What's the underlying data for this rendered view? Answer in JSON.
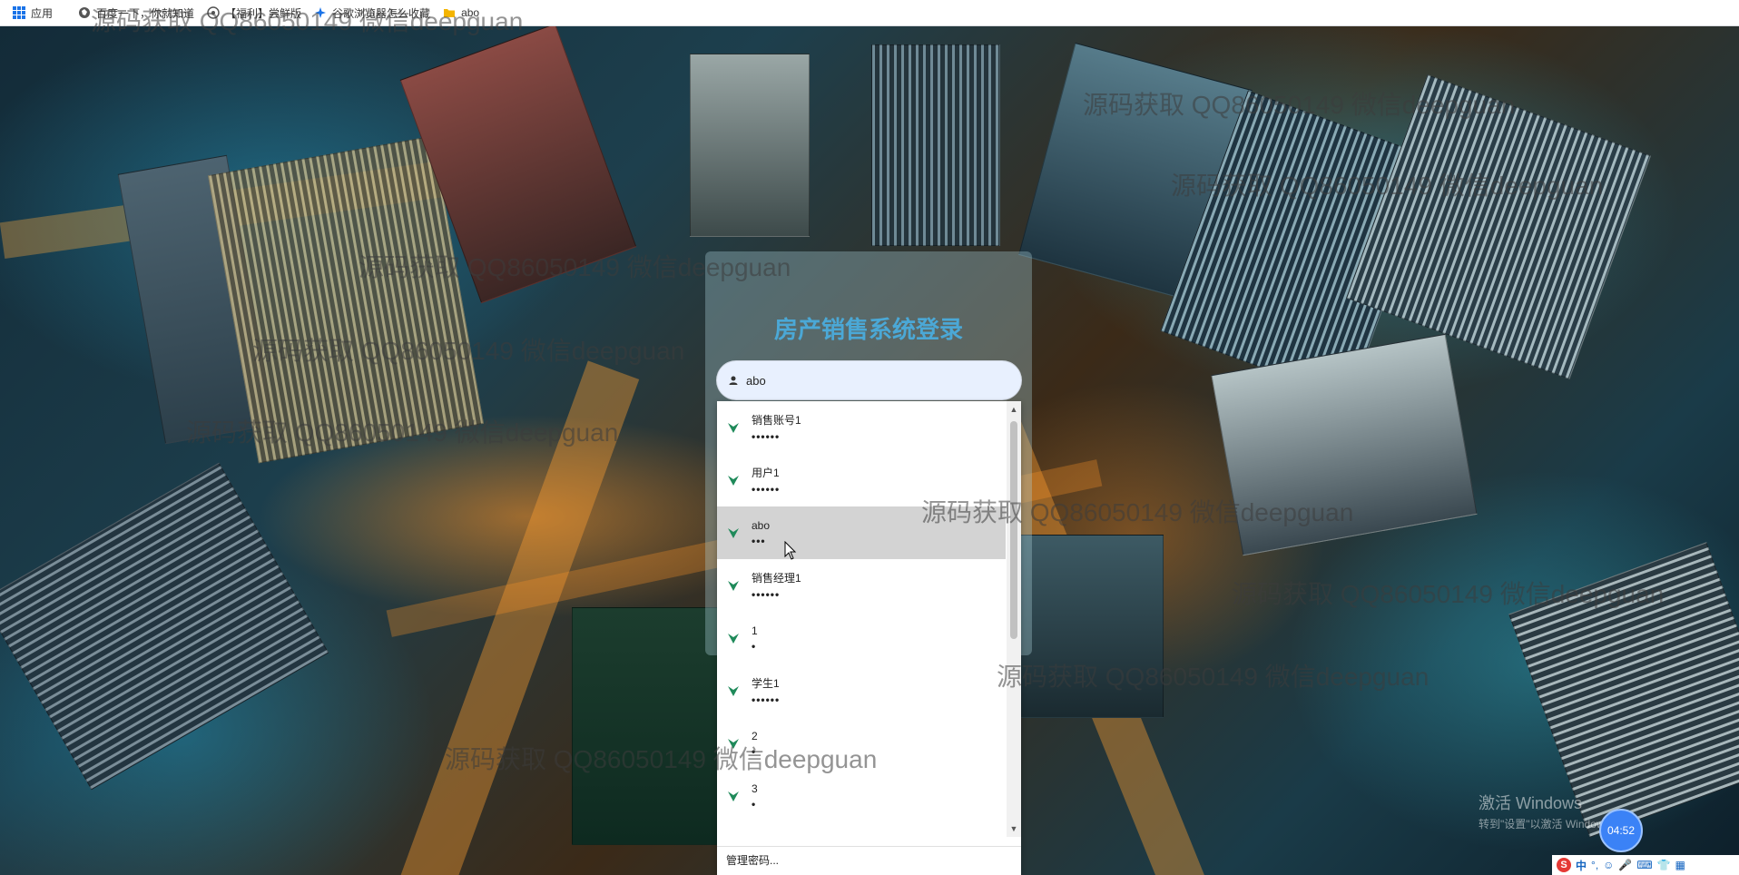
{
  "bookmarks": [
    {
      "icon": "apps-grid-icon",
      "label": "应用"
    },
    {
      "icon": "globe-icon",
      "label": "百度一下，你就知道"
    },
    {
      "icon": "globe-icon",
      "label": "【福利】尝鲜版"
    },
    {
      "icon": "sparkle-icon",
      "label": "谷歌浏览器怎么收藏"
    },
    {
      "icon": "folder-icon",
      "label": "abo"
    }
  ],
  "watermark_text": "源码获取 QQ86050149 微信deepguan",
  "login": {
    "title": "房产销售系统登录",
    "username_value": "abo"
  },
  "autofill": {
    "items": [
      {
        "name": "销售账号1",
        "masked": "••••••"
      },
      {
        "name": "用户1",
        "masked": "••••••"
      },
      {
        "name": "abo",
        "masked": "•••",
        "highlighted": true
      },
      {
        "name": "销售经理1",
        "masked": "••••••"
      },
      {
        "name": "1",
        "masked": "•"
      },
      {
        "name": "学生1",
        "masked": "••••••"
      },
      {
        "name": "2",
        "masked": "•"
      },
      {
        "name": "3",
        "masked": "•"
      }
    ],
    "manage_label": "管理密码..."
  },
  "windows": {
    "activate_title": "激活 Windows",
    "activate_sub": "转到\"设置\"以激活 Windows。"
  },
  "clock": "04:52",
  "tray": {
    "ime_mode": "中"
  },
  "colors": {
    "title_blue": "#4ba8d6",
    "field_bg": "#e8f0fe",
    "key_green": "#1f8a5a",
    "highlight": "#d3d3d3"
  }
}
